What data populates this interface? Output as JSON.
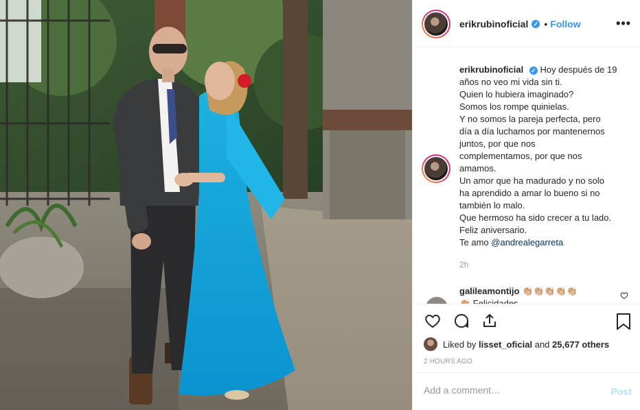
{
  "header": {
    "username": "erikrubinoficial",
    "verified_mark": "✓",
    "separator": "•",
    "follow_label": "Follow",
    "more_label": "•••"
  },
  "caption": {
    "username": "erikrubinoficial",
    "verified_mark": "✓",
    "lines": [
      "Hoy después de 19",
      "años no veo mi vida sin ti.",
      "Quien lo hubiera imaginado?",
      "Somos los rompe quinielas.",
      "Y no somos la pareja perfecta, pero",
      "día a día luchamos por mantenernos",
      "juntos, por que nos",
      "complementamos, por que nos",
      "amamos.",
      "Un amor que ha madurado y no solo",
      "ha aprendido a amar lo bueno si no",
      "también lo malo.",
      "Que hermoso ha sido crecer a tu lado.",
      "Feliz aniversario.",
      "Te amo"
    ],
    "mention": "@andrealegarreta",
    "time_ago": "2h"
  },
  "comment": {
    "username": "galileamontijo",
    "emojis": "👏🏼👏🏼👏🏼👏🏼👏🏼",
    "text": "👏🏼 Felicidades"
  },
  "likes": {
    "prefix": "Liked by",
    "user": "lisset_oficial",
    "middle": "and",
    "count": "25,677 others"
  },
  "posted_time": "2 HOURS AGO",
  "add_comment": {
    "placeholder": "Add a comment…",
    "post_label": "Post"
  },
  "icons": [
    "heart-icon",
    "comment-icon",
    "share-icon",
    "bookmark-icon",
    "more-icon"
  ],
  "colors": {
    "accent": "#3897f0",
    "post_disabled": "#b2dffc",
    "muted": "#999999"
  }
}
